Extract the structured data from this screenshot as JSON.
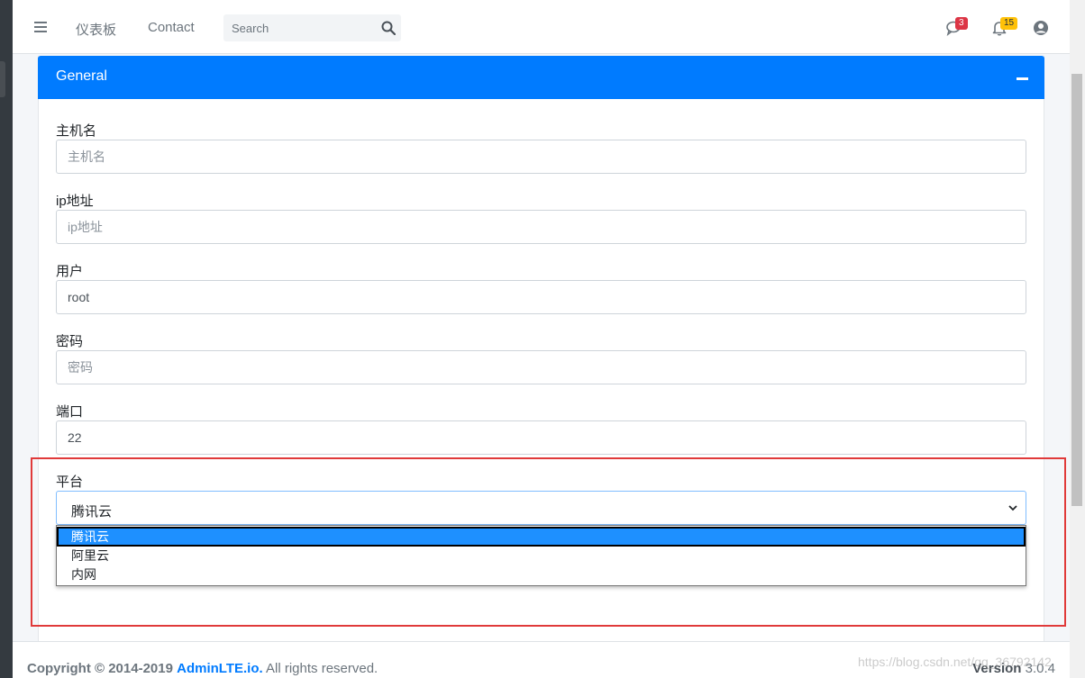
{
  "navbar": {
    "links": [
      {
        "label": "仪表板"
      },
      {
        "label": "Contact"
      }
    ],
    "search": {
      "placeholder": "Search",
      "value": ""
    },
    "messages_badge": "3",
    "notifications_badge": "15"
  },
  "card": {
    "title": "General"
  },
  "form": {
    "hostname": {
      "label": "主机名",
      "placeholder": "主机名",
      "value": ""
    },
    "ip": {
      "label": "ip地址",
      "placeholder": "ip地址",
      "value": ""
    },
    "user": {
      "label": "用户",
      "placeholder": "",
      "value": "root"
    },
    "password": {
      "label": "密码",
      "placeholder": "密码",
      "value": ""
    },
    "port": {
      "label": "端口",
      "placeholder": "",
      "value": "22"
    },
    "platform": {
      "label": "平台",
      "selected": "腾讯云",
      "options": [
        "腾讯云",
        "阿里云",
        "内网"
      ]
    }
  },
  "footer": {
    "copyright_prefix": "Copyright © 2014-2019",
    "brand_link": "AdminLTE.io.",
    "copyright_suffix": "All rights reserved.",
    "version_label": "Version",
    "version_number": "3.0.4"
  },
  "watermark": "https://blog.csdn.net/qq_36792142",
  "colors": {
    "primary": "#007bff",
    "highlight_outline": "#e03a3a",
    "badge_danger": "#dc3545",
    "badge_warning": "#ffc107"
  }
}
